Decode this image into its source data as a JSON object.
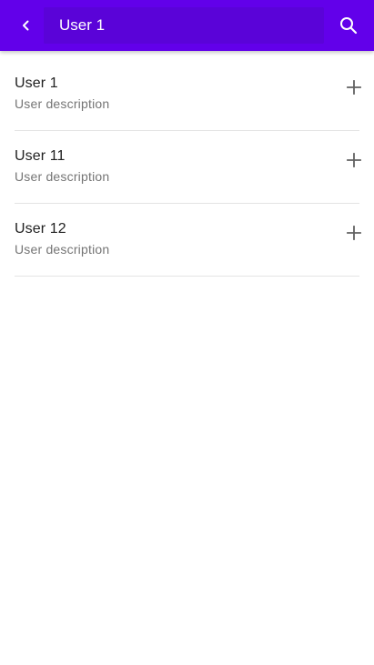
{
  "colors": {
    "app_bar": "#6200EA",
    "search_field": "#5A03D8",
    "divider": "#e4e4e4",
    "title_text": "#212121",
    "secondary_text": "#757575",
    "icon_dark": "#616161"
  },
  "app_bar": {
    "back_icon": "chevron-left-icon",
    "search_value": "User 1",
    "search_icon": "search-icon"
  },
  "items": [
    {
      "title": "User 1",
      "description": "User description",
      "action_icon": "plus-icon"
    },
    {
      "title": "User 11",
      "description": "User description",
      "action_icon": "plus-icon"
    },
    {
      "title": "User 12",
      "description": "User description",
      "action_icon": "plus-icon"
    }
  ]
}
